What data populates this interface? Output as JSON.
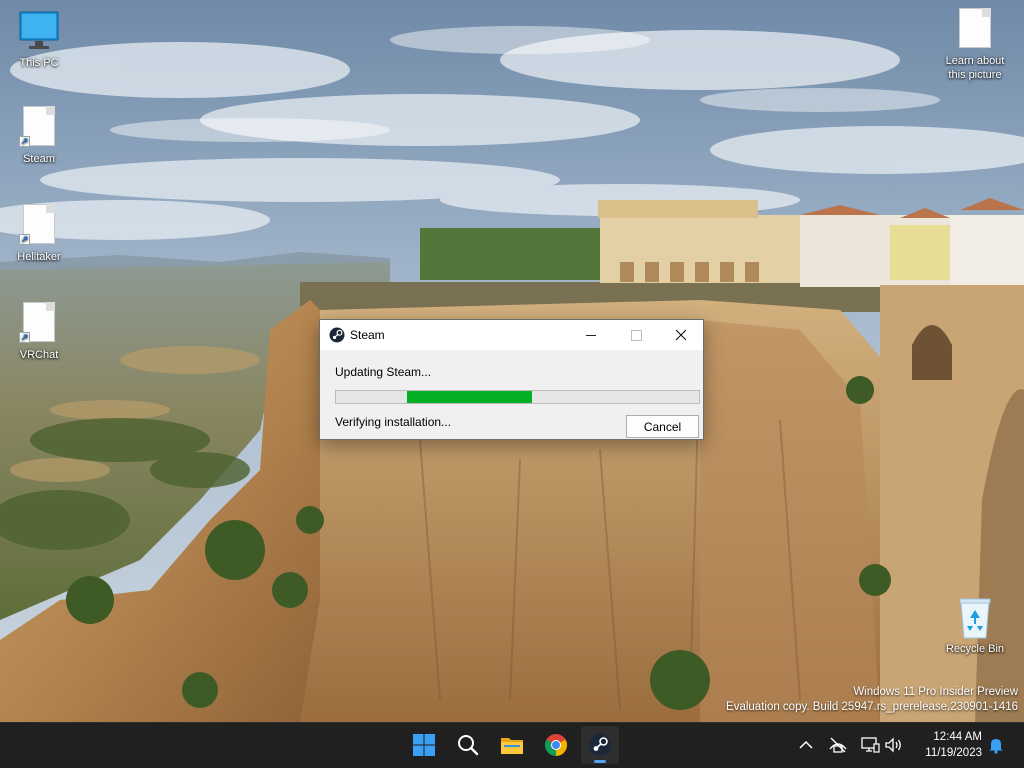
{
  "desktop": {
    "icons_left": [
      {
        "label": "This PC",
        "icon": "monitor-icon"
      },
      {
        "label": "Steam",
        "icon": "file-shortcut-icon"
      },
      {
        "label": "Helltaker",
        "icon": "file-shortcut-icon"
      },
      {
        "label": "VRChat",
        "icon": "file-shortcut-icon"
      }
    ],
    "learn_picture": {
      "line1": "Learn about",
      "line2": "this picture",
      "icon": "file-icon"
    },
    "recycle_bin": {
      "label": "Recycle Bin",
      "icon": "recycle-bin-icon"
    }
  },
  "dialog": {
    "title": "Steam",
    "app_icon": "steam-icon",
    "status": "Updating Steam...",
    "sub_status": "Verifying installation...",
    "cancel_label": "Cancel",
    "progress": {
      "start_fraction": 0.195,
      "end_fraction": 0.54,
      "color": "#06b025"
    }
  },
  "watermark": {
    "line1": "Windows 11 Pro Insider Preview",
    "line2": "Evaluation copy. Build 25947.rs_prerelease.230901-1416"
  },
  "taskbar": {
    "apps": [
      {
        "name": "start",
        "icon": "windows-start-icon"
      },
      {
        "name": "search",
        "icon": "search-icon"
      },
      {
        "name": "file-explorer",
        "icon": "folder-icon"
      },
      {
        "name": "chrome",
        "icon": "chrome-icon"
      },
      {
        "name": "steam",
        "icon": "steam-icon",
        "active": true
      }
    ],
    "tray": [
      "chevron-up-icon",
      "network-off-icon",
      "display-icon",
      "volume-icon"
    ],
    "time": "12:44 AM",
    "date": "11/19/2023",
    "notification_icon": "bell-icon"
  }
}
